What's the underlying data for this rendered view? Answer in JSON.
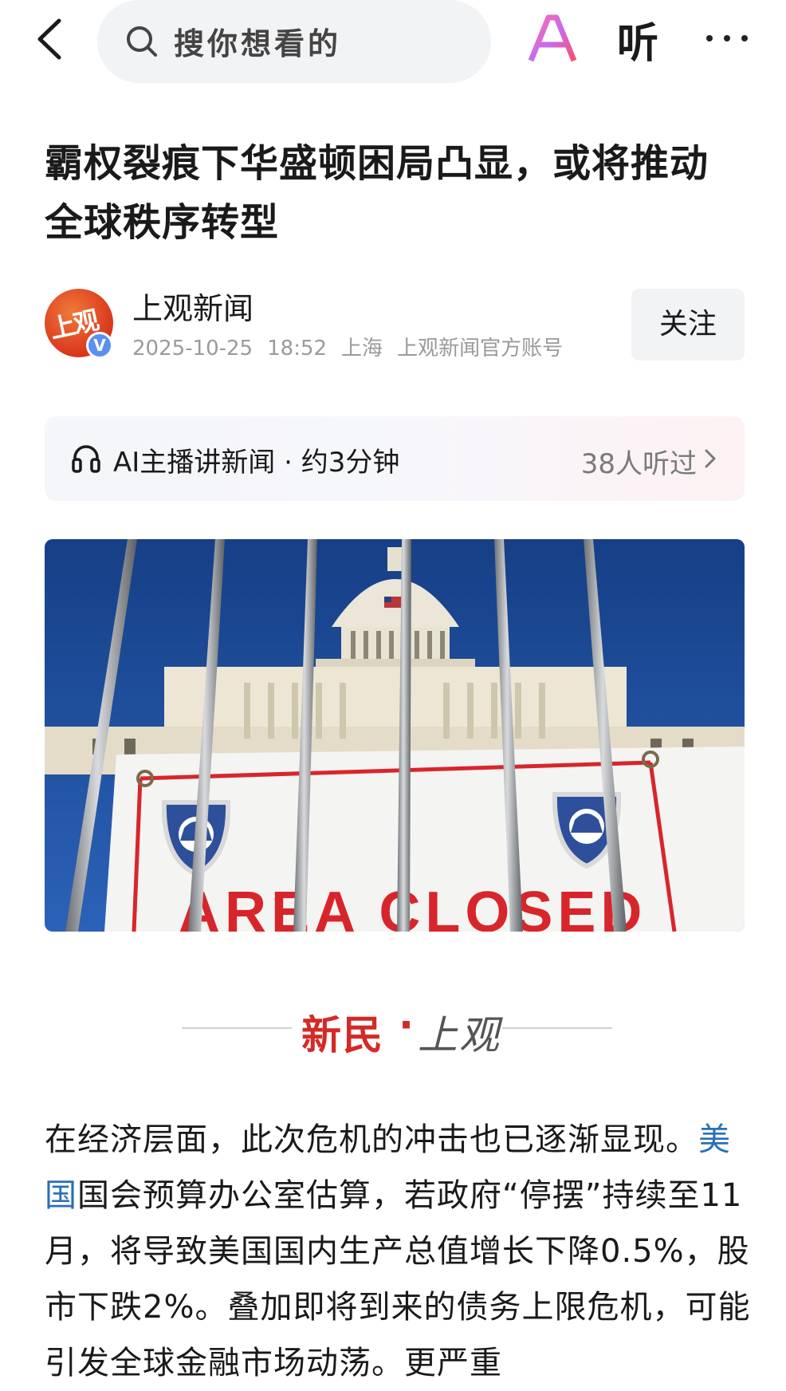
{
  "topbar": {
    "search_placeholder": "搜你想看的",
    "ai_label": "AI",
    "listen_label": "听"
  },
  "article": {
    "title": "霸权裂痕下华盛顿困局凸显，或将推动全球秩序转型",
    "author": {
      "name": "上观新闻",
      "avatar_text": "上观",
      "verified_badge": "V",
      "date": "2025-10-25",
      "time": "18:52",
      "location": "上海",
      "account_type": "上观新闻官方账号",
      "follow_label": "关注"
    },
    "ai_broadcast": {
      "label": "AI主播讲新闻 · 约3分钟",
      "listened": "38人听过"
    },
    "hero_image": {
      "sign_text": "AREA CLOSED"
    },
    "source_logo": {
      "part1": "新民",
      "dot": "·",
      "part2": "上观"
    },
    "body": {
      "p1_part1": "在经济层面，此次危机的冲击也已逐渐显现。",
      "p1_link": "美国",
      "p1_part2": "国会预算办公室估算，若政府“停摆”持续至11月，将导致美国国内生产总值增长下降0.5%，股市下跌2%。叠加即将到来的债务上限危机，可能引发全球金融市场动荡。更严重"
    }
  },
  "colors": {
    "accent_red": "#d42a26",
    "link_blue": "#2a6fb8",
    "meta_gray": "#9a9a9a",
    "sky_blue": "#1d4f9a"
  }
}
